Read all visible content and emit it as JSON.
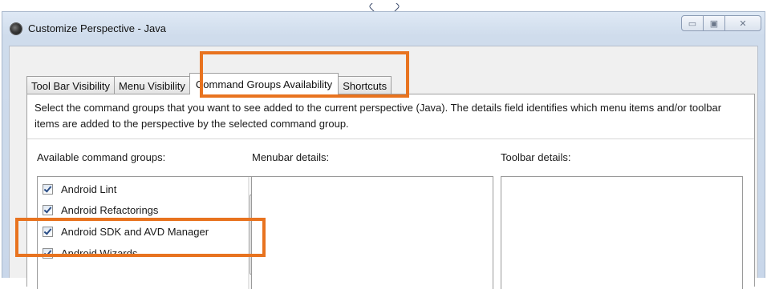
{
  "window": {
    "title": "Customize Perspective - Java",
    "buttons": {
      "minimize": "▭",
      "maximize": "▣",
      "close": "✕"
    }
  },
  "tabs": [
    {
      "label": "Tool Bar Visibility",
      "active": false
    },
    {
      "label": "Menu Visibility",
      "active": false
    },
    {
      "label": "Command Groups Availability",
      "active": true
    },
    {
      "label": "Shortcuts",
      "active": false
    }
  ],
  "panel": {
    "description": "Select the command groups that you want to see added to the current perspective (Java).  The details field identifies which menu items and/or toolbar items are added to the perspective by the selected command group.",
    "available_label": "Available command groups:",
    "menubar_label": "Menubar details:",
    "toolbar_label": "Toolbar details:",
    "command_groups": [
      {
        "label": "Android Lint",
        "checked": true
      },
      {
        "label": "Android Refactorings",
        "checked": true
      },
      {
        "label": "Android SDK and AVD Manager",
        "checked": true
      },
      {
        "label": "Android Wizards",
        "checked": true
      }
    ]
  },
  "colors": {
    "highlight": "#e8731f",
    "checkmark": "#2a4d86",
    "window_frame": "#cfdcec"
  }
}
